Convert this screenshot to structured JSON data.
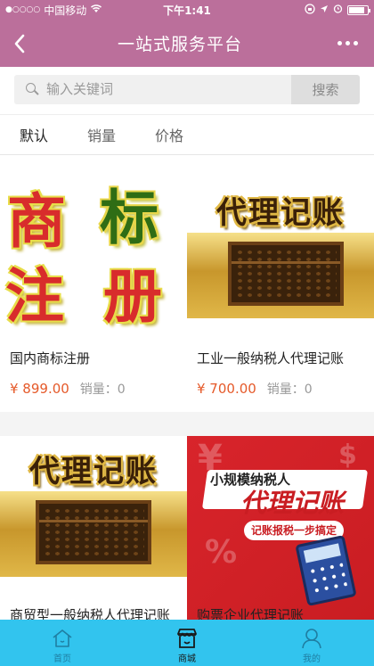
{
  "status_bar": {
    "carrier": "中国移动",
    "time": "下午1:41",
    "battery_level": 0.85
  },
  "nav": {
    "title": "一站式服务平台"
  },
  "search": {
    "placeholder": "输入关键词",
    "button_label": "搜索"
  },
  "sort_tabs": [
    "默认",
    "销量",
    "价格"
  ],
  "products": [
    {
      "name": "国内商标注册",
      "price": "¥ 899.00",
      "sales": "销量：0",
      "image_text": [
        "商",
        "标",
        "注",
        "册"
      ]
    },
    {
      "name": "工业一般纳税人代理记账",
      "price": "¥ 700.00",
      "sales": "销量：0",
      "image_text": [
        "代理记账"
      ]
    },
    {
      "name": "商贸型一般纳税人代理记账",
      "price": "",
      "sales": "",
      "image_text": [
        "代理记账"
      ]
    },
    {
      "name": "购票企业代理记账",
      "price": "",
      "sales": "",
      "image_text": [
        "小规模纳税人",
        "代理记账",
        "记账报税一步搞定"
      ]
    }
  ],
  "tab_bar": {
    "items": [
      {
        "label": "首页",
        "icon": "home-icon"
      },
      {
        "label": "商城",
        "icon": "shop-icon"
      },
      {
        "label": "我的",
        "icon": "user-icon"
      }
    ],
    "active_index": 1
  },
  "colors": {
    "nav_bg": "#bb6f9b",
    "tab_bar_bg": "#32c4ee",
    "price": "#e55a2a"
  }
}
